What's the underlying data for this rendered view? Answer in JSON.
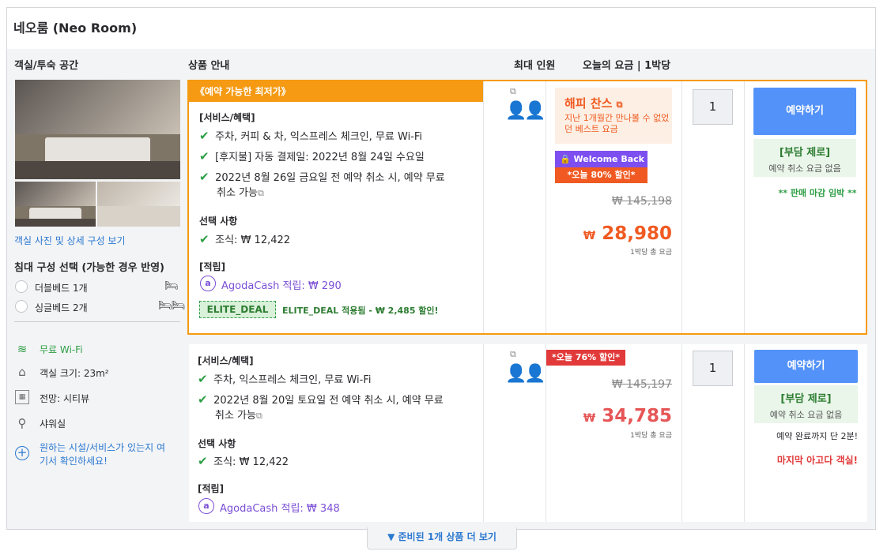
{
  "hotel": {
    "title": "네오룸 (Neo Room)"
  },
  "headers": {
    "room": "객실/투숙 공간",
    "product": "상품 안내",
    "max": "최대 인원",
    "price": "오늘의 요금 | 1박당"
  },
  "room": {
    "photo_link": "객실 사진 및 상세 구성 보기",
    "bed_title": "침대 구성 선택 (가능한 경우 반영)",
    "beds": [
      "더블베드 1개",
      "싱글베드 2개"
    ],
    "features": [
      {
        "icon": "wifi-icon",
        "label": "무료 Wi-Fi"
      },
      {
        "icon": "room-size-icon",
        "label": "객실 크기: 23m²"
      },
      {
        "icon": "view-icon",
        "label": "전망: 시티뷰"
      },
      {
        "icon": "shower-icon",
        "label": "샤워실"
      }
    ],
    "ask_line1": "원하는 시설/서비스가 있는지 여",
    "ask_line2": "기서 확인하세요!"
  },
  "offer1": {
    "badge": "《예약 가능한 최저가》",
    "services_title": "[서비스/혜택]",
    "services": [
      "주차, 커피 & 차, 익스프레스 체크인, 무료 Wi-Fi",
      "[후지불] 자동 결제일: 2022년 8월 24일 수요일",
      "2022년 8월 26일 금요일 전 예약 취소 시, 예약 무료",
      "취소 가능"
    ],
    "options_title": "선택 사항",
    "breakfast": "조식: ₩ 12,422",
    "earn_title": "[적립]",
    "agoda_cash": "AgodaCash 적립: ₩ 290",
    "coupon_code": "ELITE_DEAL",
    "coupon_text": "ELITE_DEAL 적용됨 - ₩ 2,485 할인!",
    "happy_title": "해피 찬스",
    "happy_desc1": "지난 1개월간 만나볼 수 없었",
    "happy_desc2": "던 베스트 요금",
    "welcome": "Welcome Back",
    "today_discount": "*오늘 80% 할인*",
    "original_price": "₩ 145,198",
    "currency": "₩",
    "price": "28,980",
    "per_night": "1박당 총 요금",
    "qty": "1",
    "book": "예약하기",
    "free_title": "[부담 제로]",
    "free_desc": "예약 취소 요금 없음",
    "closing": "** 판매 마감 임박 **"
  },
  "offer2": {
    "services_title": "[서비스/혜택]",
    "services": [
      "주차, 익스프레스 체크인, 무료 Wi-Fi",
      "2022년 8월 20일 토요일 전 예약 취소 시, 예약 무료",
      "취소 가능"
    ],
    "options_title": "선택 사항",
    "breakfast": "조식: ₩ 12,422",
    "earn_title": "[적립]",
    "agoda_cash": "AgodaCash 적립: ₩ 348",
    "today_discount": "*오늘 76% 할인*",
    "original_price": "₩ 145,197",
    "currency": "₩",
    "price": "34,785",
    "per_night": "1박당 총 요금",
    "qty": "1",
    "book": "예약하기",
    "free_title": "[부담 제로]",
    "free_desc": "예약 취소 요금 없음",
    "remaining": "예약 완료까지 단 2분!",
    "last_room": "마지막 아고다 객실!"
  },
  "more_button": "준비된 1개 상품 더 보기",
  "colors": {
    "accent_orange": "#f59a12",
    "price_red": "#f05a22",
    "book_blue": "#5392f9",
    "welcome_purple": "#7d4ff0"
  }
}
